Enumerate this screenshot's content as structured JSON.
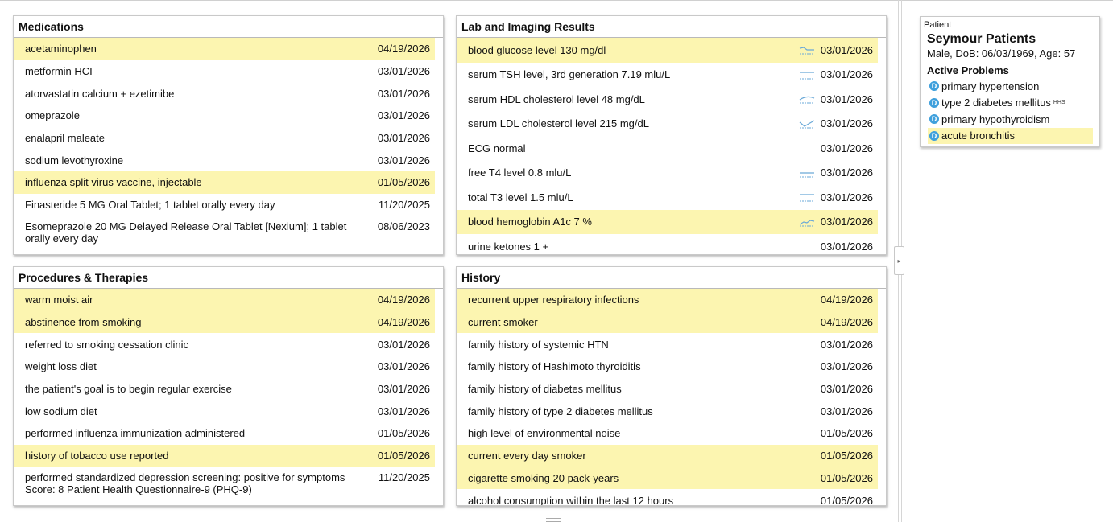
{
  "medications": {
    "title": "Medications",
    "rows": [
      {
        "label": "acetaminophen",
        "date": "04/19/2026",
        "highlight": true
      },
      {
        "label": "metformin HCI",
        "date": "03/01/2026",
        "highlight": false
      },
      {
        "label": "atorvastatin calcium + ezetimibe",
        "date": "03/01/2026",
        "highlight": false
      },
      {
        "label": "omeprazole",
        "date": "03/01/2026",
        "highlight": false
      },
      {
        "label": "enalapril maleate",
        "date": "03/01/2026",
        "highlight": false
      },
      {
        "label": "sodium levothyroxine",
        "date": "03/01/2026",
        "highlight": false
      },
      {
        "label": "influenza split virus vaccine, injectable",
        "date": "01/05/2026",
        "highlight": true
      },
      {
        "label": "Finasteride 5 MG Oral Tablet; 1 tablet orally every day",
        "date": "11/20/2025",
        "highlight": false
      },
      {
        "label": "Esomeprazole 20 MG Delayed Release Oral Tablet [Nexium]; 1 tablet orally every day",
        "date": "08/06/2023",
        "highlight": false,
        "tall": true
      }
    ]
  },
  "labs": {
    "title": "Lab and Imaging Results",
    "rows": [
      {
        "label": "blood glucose level 130 mg/dl",
        "date": "03/01/2026",
        "highlight": true,
        "trend": "down-flat"
      },
      {
        "label": "serum TSH level, 3rd generation 7.19 mlu/L",
        "date": "03/01/2026",
        "highlight": false,
        "trend": "flat"
      },
      {
        "label": "serum HDL cholesterol level 48 mg/dL",
        "date": "03/01/2026",
        "highlight": false,
        "trend": "arc"
      },
      {
        "label": "serum LDL cholesterol level 215 mg/dL",
        "date": "03/01/2026",
        "highlight": false,
        "trend": "dip-up"
      },
      {
        "label": "ECG normal",
        "date": "03/01/2026",
        "highlight": false,
        "trend": "none"
      },
      {
        "label": "free T4 level 0.8 mlu/L",
        "date": "03/01/2026",
        "highlight": false,
        "trend": "flat-low"
      },
      {
        "label": "total T3 level 1.5 mlu/L",
        "date": "03/01/2026",
        "highlight": false,
        "trend": "flat"
      },
      {
        "label": "blood hemoglobin A1c 7 %",
        "date": "03/01/2026",
        "highlight": true,
        "trend": "rise"
      },
      {
        "label": "urine ketones 1 +",
        "date": "03/01/2026",
        "highlight": false,
        "trend": "none"
      }
    ]
  },
  "procedures": {
    "title": "Procedures & Therapies",
    "rows": [
      {
        "label": "warm moist air",
        "date": "04/19/2026",
        "highlight": true
      },
      {
        "label": "abstinence from smoking",
        "date": "04/19/2026",
        "highlight": true
      },
      {
        "label": "referred to smoking cessation clinic",
        "date": "03/01/2026",
        "highlight": false
      },
      {
        "label": "weight loss diet",
        "date": "03/01/2026",
        "highlight": false
      },
      {
        "label": "the patient's goal is to begin regular exercise",
        "date": "03/01/2026",
        "highlight": false
      },
      {
        "label": "low sodium diet",
        "date": "03/01/2026",
        "highlight": false
      },
      {
        "label": "performed influenza immunization administered",
        "date": "01/05/2026",
        "highlight": false
      },
      {
        "label": "history of tobacco use reported",
        "date": "01/05/2026",
        "highlight": true
      },
      {
        "label": "performed standardized depression screening: positive for symptoms Score: 8 Patient Health Questionnaire-9 (PHQ-9)",
        "date": "11/20/2025",
        "highlight": false,
        "tall": true
      }
    ]
  },
  "history": {
    "title": "History",
    "rows": [
      {
        "label": "recurrent upper respiratory infections",
        "date": "04/19/2026",
        "highlight": true
      },
      {
        "label": "current smoker",
        "date": "04/19/2026",
        "highlight": true
      },
      {
        "label": "family history of systemic HTN",
        "date": "03/01/2026",
        "highlight": false
      },
      {
        "label": "family history of Hashimoto thyroiditis",
        "date": "03/01/2026",
        "highlight": false
      },
      {
        "label": "family history of diabetes mellitus",
        "date": "03/01/2026",
        "highlight": false
      },
      {
        "label": "family history of type 2 diabetes mellitus",
        "date": "03/01/2026",
        "highlight": false
      },
      {
        "label": "high level of environmental noise",
        "date": "01/05/2026",
        "highlight": false
      },
      {
        "label": "current every day smoker",
        "date": "01/05/2026",
        "highlight": true
      },
      {
        "label": "cigarette smoking 20 pack-years",
        "date": "01/05/2026",
        "highlight": true
      },
      {
        "label": "alcohol consumption within the last 12 hours",
        "date": "01/05/2026",
        "highlight": false
      }
    ]
  },
  "patient": {
    "caption": "Patient",
    "name": "Seymour Patients",
    "demographics": "Male, DoB: 06/03/1969, Age: 57",
    "active_problems_title": "Active Problems",
    "problem_icon_letter": "D",
    "problems": [
      {
        "label": "primary hypertension",
        "sup": "",
        "highlight": false
      },
      {
        "label": "type 2 diabetes mellitus",
        "sup": "HHS",
        "highlight": false
      },
      {
        "label": "primary hypothyroidism",
        "sup": "",
        "highlight": false
      },
      {
        "label": "acute bronchitis",
        "sup": "",
        "highlight": true
      }
    ]
  },
  "colors": {
    "highlight": "#fcf5b0",
    "problem_icon": "#3fa0dc",
    "trend": "#6aa9d8"
  },
  "splitter": {
    "handle_icon": "chevron-right-icon",
    "glyph": "▸"
  }
}
